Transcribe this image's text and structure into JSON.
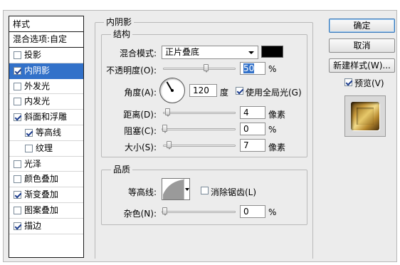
{
  "sidebar": {
    "title": "样式",
    "blend_options": "混合选项:自定",
    "items": [
      {
        "label": "投影",
        "checked": false
      },
      {
        "label": "内阴影",
        "checked": true,
        "selected": true
      },
      {
        "label": "外发光",
        "checked": false
      },
      {
        "label": "内发光",
        "checked": false
      },
      {
        "label": "斜面和浮雕",
        "checked": true
      },
      {
        "label": "等高线",
        "checked": true,
        "sub": true
      },
      {
        "label": "纹理",
        "checked": false,
        "sub": true
      },
      {
        "label": "光泽",
        "checked": false
      },
      {
        "label": "颜色叠加",
        "checked": false
      },
      {
        "label": "渐变叠加",
        "checked": true
      },
      {
        "label": "图案叠加",
        "checked": false
      },
      {
        "label": "描边",
        "checked": true
      }
    ]
  },
  "panel": {
    "title": "内阴影",
    "structure": {
      "title": "结构",
      "blend_mode_label": "混合模式:",
      "blend_mode_value": "正片叠底",
      "shadow_color": "#000000",
      "opacity_label": "不透明度(O):",
      "opacity_value": "50",
      "angle_label": "角度(A):",
      "angle_value": "120",
      "degree_unit": "度",
      "global_light_label": "使用全局光(G)",
      "global_light_checked": true,
      "distance_label": "距离(D):",
      "distance_value": "4",
      "choke_label": "阻塞(C):",
      "choke_value": "0",
      "size_label": "大小(S):",
      "size_value": "7",
      "pixel_unit": "像素",
      "percent_unit": "%"
    },
    "quality": {
      "title": "品质",
      "contour_label": "等高线:",
      "anti_alias_label": "消除锯齿(L)",
      "anti_alias_checked": false,
      "noise_label": "杂色(N):",
      "noise_value": "0",
      "percent_unit": "%"
    }
  },
  "buttons": {
    "ok": "确定",
    "cancel": "取消",
    "new_style": "新建样式(W)...",
    "preview_label": "预览(V)",
    "preview_checked": true
  }
}
